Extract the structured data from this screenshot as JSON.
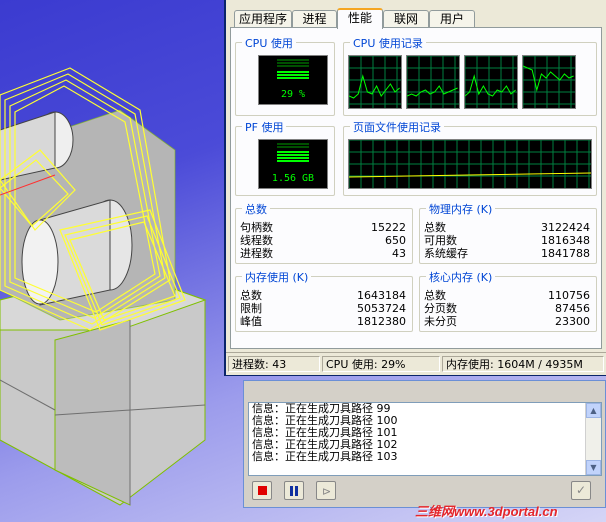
{
  "taskmgr": {
    "tabs": [
      "应用程序",
      "进程",
      "性能",
      "联网",
      "用户"
    ],
    "active_tab": "性能",
    "cpu_usage": {
      "title": "CPU 使用",
      "value": "29 %",
      "percent": 29
    },
    "cpu_history": {
      "title": "CPU 使用记录",
      "cores": 4
    },
    "pf_usage": {
      "title": "PF 使用",
      "value": "1.56 GB"
    },
    "pf_history": {
      "title": "页面文件使用记录"
    },
    "totals": {
      "title": "总数",
      "rows": [
        {
          "label": "句柄数",
          "value": "15222"
        },
        {
          "label": "线程数",
          "value": "650"
        },
        {
          "label": "进程数",
          "value": "43"
        }
      ]
    },
    "physical_memory": {
      "title": "物理内存 (K)",
      "rows": [
        {
          "label": "总数",
          "value": "3122424"
        },
        {
          "label": "可用数",
          "value": "1816348"
        },
        {
          "label": "系统缓存",
          "value": "1841788"
        }
      ]
    },
    "commit_charge": {
      "title": "内存使用 (K)",
      "rows": [
        {
          "label": "总数",
          "value": "1643184"
        },
        {
          "label": "限制",
          "value": "5053724"
        },
        {
          "label": "峰值",
          "value": "1812380"
        }
      ]
    },
    "kernel_memory": {
      "title": "核心内存 (K)",
      "rows": [
        {
          "label": "总数",
          "value": "110756"
        },
        {
          "label": "分页数",
          "value": "87456"
        },
        {
          "label": "未分页",
          "value": "23300"
        }
      ]
    },
    "status": {
      "processes": "进程数: 43",
      "cpu": "CPU 使用: 29%",
      "memory": "内存使用: 1604M / 4935M"
    }
  },
  "log": {
    "lines": [
      "信息：正在生成刀具路径 99",
      "信息：正在生成刀具路径 100",
      "信息：正在生成刀具路径 101",
      "信息：正在生成刀具路径 102",
      "信息：正在生成刀具路径 103"
    ]
  },
  "watermark": "三维网www.3dportal.cn",
  "colors": {
    "graph_bg": "#000000",
    "graph_grid": "#008040",
    "graph_line": "#00ff00",
    "viewport_wire": "#ffff33",
    "viewport_magenta": "#ff00ff"
  }
}
